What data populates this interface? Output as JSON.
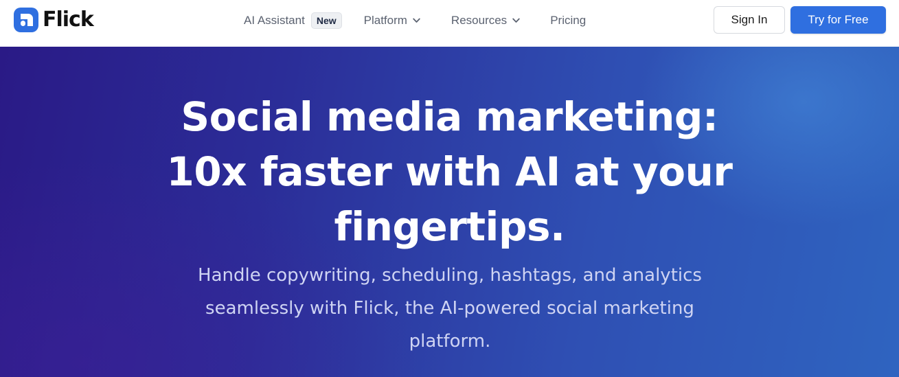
{
  "brand": {
    "name": "Flick",
    "logo_icon": "flick-logo-icon",
    "accent_color": "#2f6fe0"
  },
  "nav": {
    "ai_assistant": "AI Assistant",
    "new_badge": "New",
    "platform": "Platform",
    "resources": "Resources",
    "pricing": "Pricing",
    "dropdown_icon": "chevron-down-icon"
  },
  "actions": {
    "sign_in": "Sign In",
    "try_free": "Try for Free"
  },
  "hero": {
    "title_lines": [
      "Social media marketing:",
      "10x faster with AI at your",
      "fingertips."
    ],
    "subtitle_lines": [
      "Handle copywriting, scheduling, hashtags, and analytics",
      "seamlessly with Flick, the AI-powered social marketing",
      "platform."
    ]
  }
}
